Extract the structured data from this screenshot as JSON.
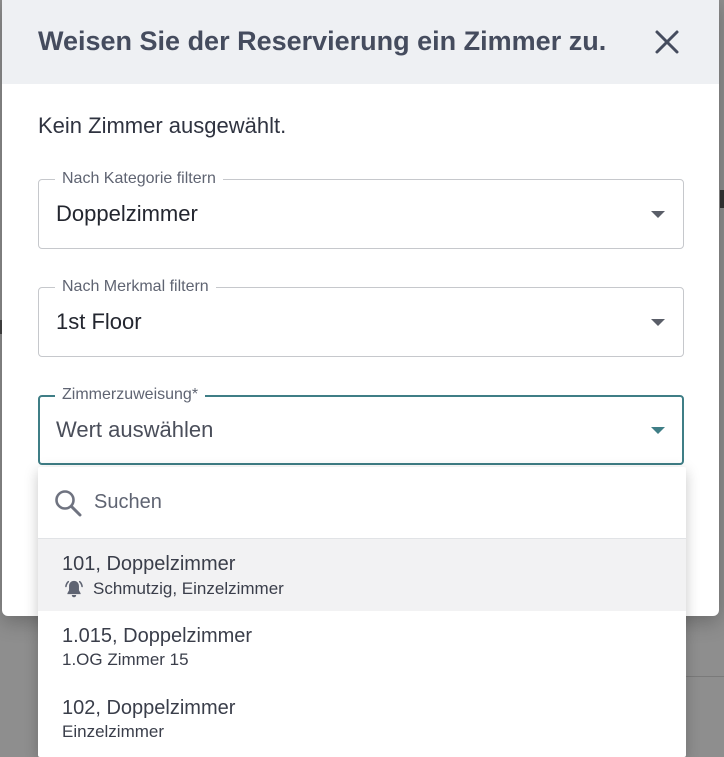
{
  "dialog": {
    "title": "Weisen Sie der Reservierung ein Zimmer zu.",
    "status": "Kein Zimmer ausgewählt."
  },
  "filters": {
    "category": {
      "label": "Nach Kategorie filtern",
      "value": "Doppelzimmer"
    },
    "feature": {
      "label": "Nach Merkmal filtern",
      "value": "1st Floor"
    },
    "room": {
      "label": "Zimmerzuweisung*",
      "value": "Wert auswählen"
    }
  },
  "dropdown": {
    "search_placeholder": "Suchen",
    "options": [
      {
        "title": "101, Doppelzimmer",
        "subtitle": "Schmutzig, Einzelzimmer",
        "icon": "bell-icon"
      },
      {
        "title": "1.015, Doppelzimmer",
        "subtitle": "1.OG Zimmer 15"
      },
      {
        "title": "102, Doppelzimmer",
        "subtitle": "Einzelzimmer"
      }
    ]
  },
  "colors": {
    "header_bg": "#eef0f3",
    "title_text": "#454c5e",
    "focus_accent": "#3f7e86",
    "highlight_bg": "#f2f2f3"
  }
}
